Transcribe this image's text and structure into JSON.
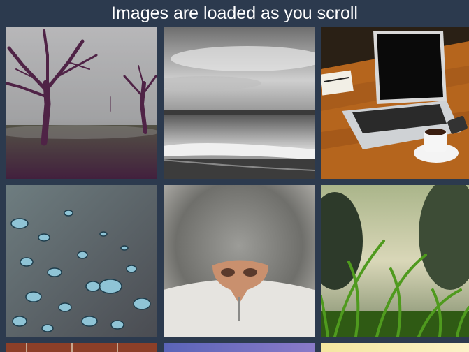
{
  "header": {
    "title": "Images are loaded as you scroll"
  },
  "gallery": {
    "images": [
      {
        "name": "foggy-trees-photo"
      },
      {
        "name": "black-white-beach-photo"
      },
      {
        "name": "laptop-coffee-desk-photo"
      },
      {
        "name": "water-droplets-photo"
      },
      {
        "name": "cat-nose-closeup-photo"
      },
      {
        "name": "grass-blades-trees-photo"
      },
      {
        "name": "brick-wall-photo"
      },
      {
        "name": "blue-purple-sky-photo"
      },
      {
        "name": "bright-yellow-light-photo"
      }
    ]
  },
  "colors": {
    "page_background": "#2c3a4e",
    "header_text": "#ffffff"
  }
}
